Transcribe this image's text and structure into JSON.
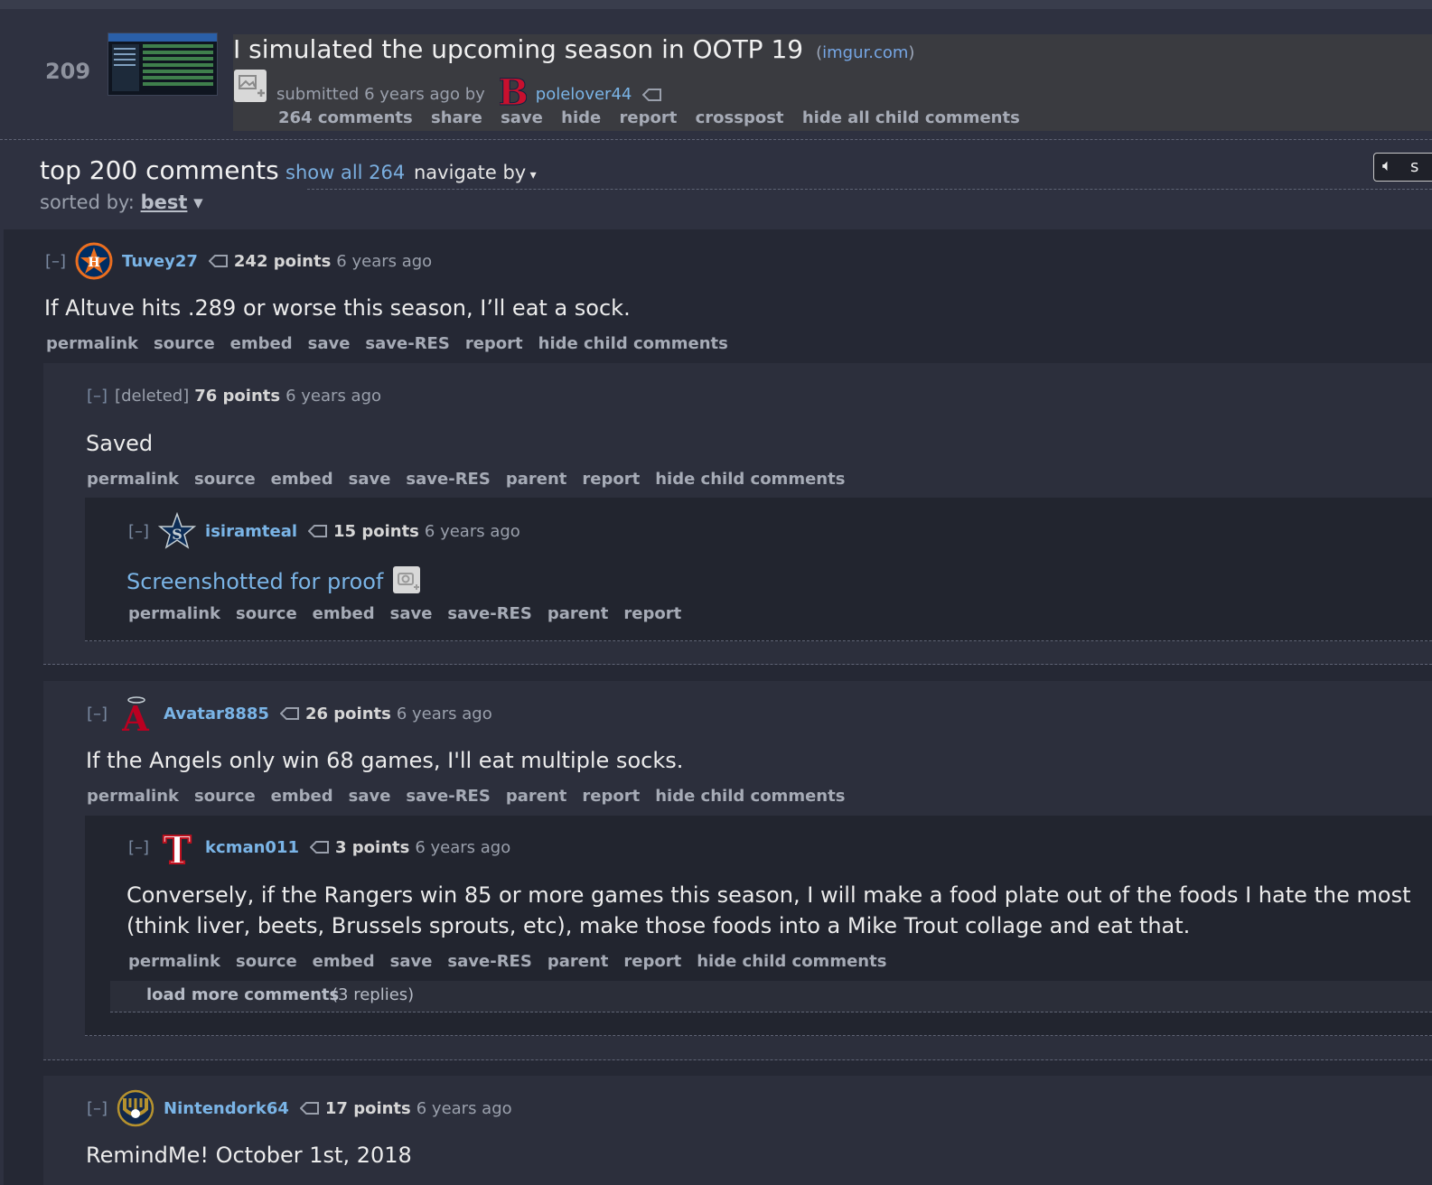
{
  "post": {
    "score": "209",
    "title": "I simulated the upcoming season in OOTP 19",
    "domain": "imgur.com",
    "submitted": "submitted 6 years ago by",
    "author": "polelover44",
    "actions": [
      "264 comments",
      "share",
      "save",
      "hide",
      "report",
      "crosspost",
      "hide all child comments"
    ]
  },
  "commentarea": {
    "title": "top 200 comments",
    "show_all": "show all 264",
    "navigate": "navigate by",
    "sorted_label": "sorted by:",
    "sorted_value": "best",
    "speaker_label": "s"
  },
  "comments": [
    {
      "expand": "[–]",
      "author": "Tuvey27",
      "points": "242 points",
      "ago": "6 years ago",
      "body": "If Altuve hits .289 or worse this season, I’ll eat a sock.",
      "actions": [
        "permalink",
        "source",
        "embed",
        "save",
        "save-RES",
        "report",
        "hide child comments"
      ]
    },
    {
      "expand": "[–]",
      "author": "[deleted]",
      "points": "76 points",
      "ago": "6 years ago",
      "body": "Saved",
      "actions": [
        "permalink",
        "source",
        "embed",
        "save",
        "save-RES",
        "parent",
        "report",
        "hide child comments"
      ]
    },
    {
      "expand": "[–]",
      "author": "isiramteal",
      "points": "15 points",
      "ago": "6 years ago",
      "body": "Screenshotted for proof",
      "actions": [
        "permalink",
        "source",
        "embed",
        "save",
        "save-RES",
        "parent",
        "report"
      ]
    },
    {
      "expand": "[–]",
      "author": "Avatar8885",
      "points": "26 points",
      "ago": "6 years ago",
      "body": "If the Angels only win 68 games, I'll eat multiple socks.",
      "actions": [
        "permalink",
        "source",
        "embed",
        "save",
        "save-RES",
        "parent",
        "report",
        "hide child comments"
      ]
    },
    {
      "expand": "[–]",
      "author": "kcman011",
      "points": "3 points",
      "ago": "6 years ago",
      "body_line1": "Conversely, if the Rangers win 85 or more games this season, I will make a food plate out of the foods I hate the most",
      "body_line2": "(think liver, beets, Brussels sprouts, etc), make those foods into a Mike Trout collage and eat that.",
      "actions": [
        "permalink",
        "source",
        "embed",
        "save",
        "save-RES",
        "parent",
        "report",
        "hide child comments"
      ],
      "load_more": "load more comments",
      "load_more_count": "(3 replies)"
    },
    {
      "expand": "[–]",
      "author": "Nintendork64",
      "points": "17 points",
      "ago": "6 years ago",
      "body": "RemindMe! October 1st, 2018"
    }
  ],
  "colors": {
    "background": "#2e3140",
    "link": "#7ab4e6",
    "muted": "#9aa0ac"
  }
}
